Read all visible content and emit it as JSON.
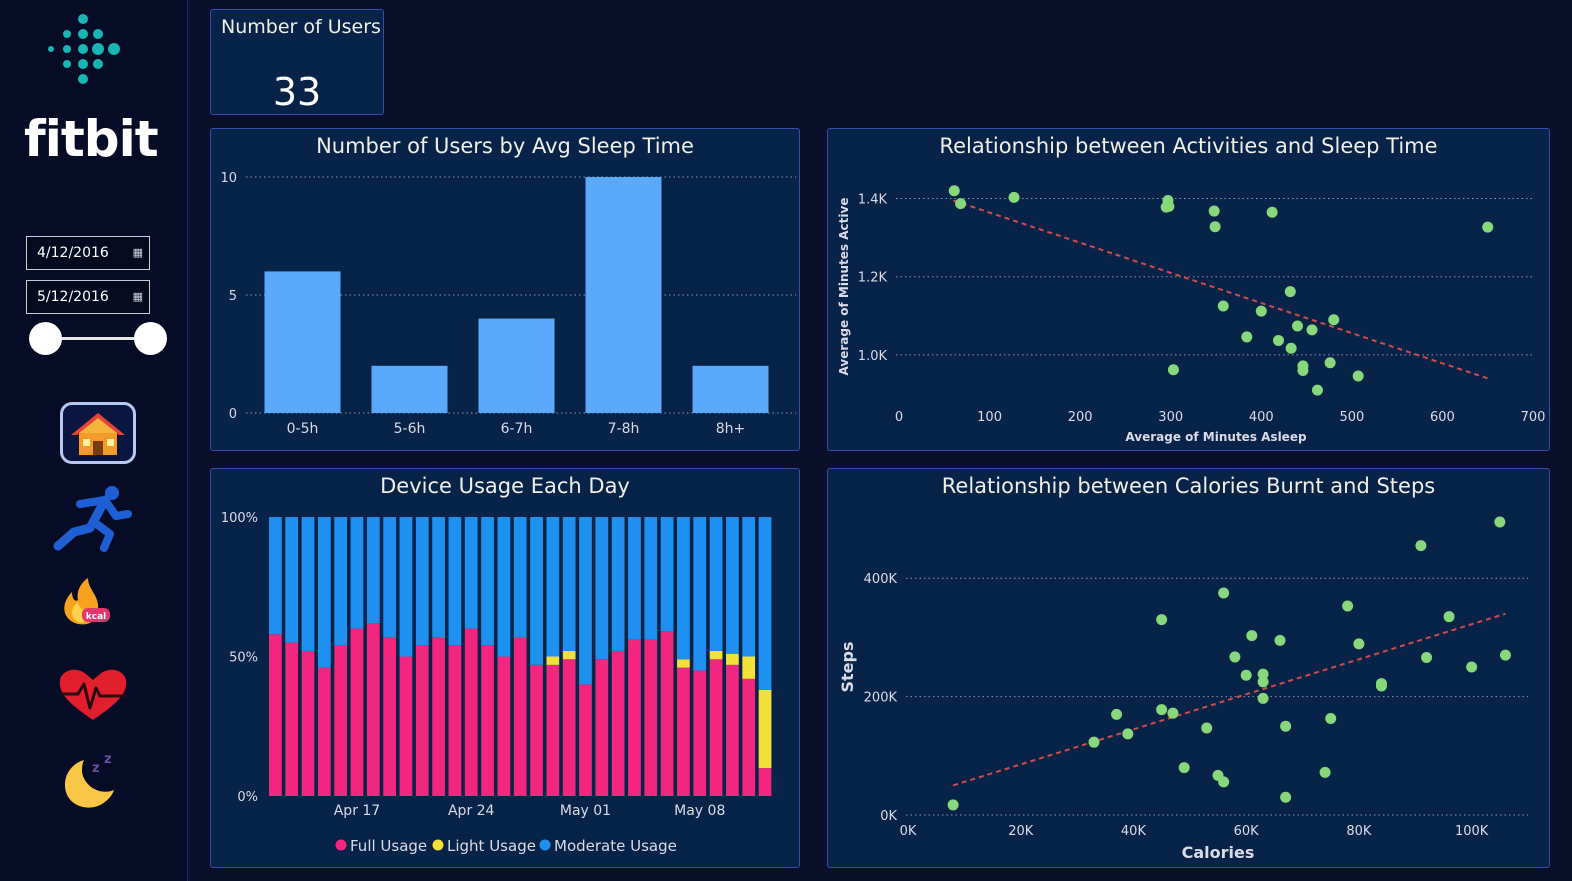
{
  "brand": {
    "name": "fitbit"
  },
  "filters": {
    "start_date": "4/12/2016",
    "end_date": "5/12/2016"
  },
  "nav": {
    "items": [
      {
        "icon": "home-icon",
        "active": true
      },
      {
        "icon": "running-icon",
        "active": false
      },
      {
        "icon": "kcal-flame-icon",
        "active": false
      },
      {
        "icon": "heartbeat-icon",
        "active": false
      },
      {
        "icon": "sleep-moon-icon",
        "active": false
      }
    ]
  },
  "kpi": {
    "label": "Number of Users",
    "value": "33"
  },
  "colors": {
    "bar": "#5aa9fa",
    "full": "#f0267f",
    "light": "#f3e13a",
    "moderate": "#1e90f0",
    "points": "#86d87a",
    "trend": "#d24a4a",
    "card_bg": "#072448"
  },
  "chart_data": [
    {
      "id": "sleep",
      "type": "bar",
      "title": "Number of Users by Avg Sleep Time",
      "categories": [
        "0-5h",
        "5-6h",
        "6-7h",
        "7-8h",
        "8h+"
      ],
      "values": [
        6,
        2,
        4,
        10,
        2
      ],
      "ylim": [
        0,
        10
      ],
      "yticks": [
        "0",
        "5",
        "10"
      ],
      "grid": true
    },
    {
      "id": "usage",
      "type": "bar",
      "stacked": "percent",
      "title": "Device Usage Each Day",
      "xticks": [
        "Apr 17",
        "Apr 24",
        "May 01",
        "May 08"
      ],
      "yticks": [
        "0%",
        "50%",
        "100%"
      ],
      "legend": "bottom",
      "series": [
        {
          "name": "Full Usage",
          "values": [
            58,
            55,
            52,
            46,
            54,
            60,
            62,
            57,
            50,
            54,
            57,
            54,
            60,
            54,
            50,
            57,
            47,
            47,
            49,
            40,
            49,
            52,
            56,
            56,
            59,
            46,
            45,
            49,
            47,
            42,
            10
          ]
        },
        {
          "name": "Light Usage",
          "values": [
            0,
            0,
            0,
            0,
            0,
            0,
            0,
            0,
            0,
            0,
            0,
            0,
            0,
            0,
            0,
            0,
            0,
            3,
            3,
            0,
            0,
            0,
            0,
            0,
            0,
            3,
            0,
            3,
            4,
            8,
            28
          ]
        },
        {
          "name": "Moderate Usage",
          "values": [
            42,
            45,
            48,
            54,
            46,
            40,
            38,
            43,
            50,
            46,
            43,
            46,
            40,
            46,
            50,
            43,
            53,
            50,
            48,
            60,
            51,
            48,
            44,
            44,
            41,
            51,
            55,
            48,
            49,
            50,
            62
          ]
        }
      ]
    },
    {
      "id": "activity",
      "type": "scatter",
      "title": "Relationship between Activities and Sleep Time",
      "xlabel": "Average of Minutes Asleep",
      "ylabel": "Average of Minutes Active",
      "xticks": [
        "0",
        "100",
        "200",
        "300",
        "400",
        "500",
        "600",
        "700"
      ],
      "yticks": [
        "1.0K",
        "1.2K",
        "1.4K"
      ],
      "xlim": [
        0,
        700
      ],
      "ylim": [
        900,
        1450
      ],
      "trend": [
        [
          60,
          1395
        ],
        [
          650,
          940
        ]
      ],
      "x": [
        61,
        68,
        127,
        295,
        297,
        298,
        348,
        349,
        412,
        358,
        432,
        400,
        384,
        433,
        419,
        440,
        480,
        456,
        446,
        446,
        462,
        476,
        303,
        507,
        650
      ],
      "y": [
        1420,
        1387,
        1403,
        1378,
        1395,
        1380,
        1368,
        1328,
        1365,
        1125,
        1162,
        1112,
        1046,
        1017,
        1037,
        1074,
        1090,
        1064,
        972,
        960,
        910,
        980,
        962,
        946,
        1327
      ]
    },
    {
      "id": "calories",
      "type": "scatter",
      "title": "Relationship between Calories Burnt and Steps",
      "xlabel": "Calories",
      "ylabel": "Steps",
      "xticks": [
        "0K",
        "20K",
        "40K",
        "60K",
        "80K",
        "100K"
      ],
      "yticks": [
        "0K",
        "200K",
        "400K"
      ],
      "xlim": [
        0,
        110000
      ],
      "ylim": [
        0,
        500000
      ],
      "trend": [
        [
          8000,
          50000
        ],
        [
          106000,
          340000
        ]
      ],
      "x": [
        8000,
        33000,
        37000,
        39000,
        45000,
        45000,
        47000,
        49000,
        53000,
        55000,
        56000,
        56000,
        58000,
        60000,
        61000,
        63000,
        63000,
        63000,
        66000,
        67000,
        67000,
        74000,
        75000,
        78000,
        80000,
        84000,
        84000,
        91000,
        92000,
        96000,
        100000,
        105000,
        106000
      ],
      "y": [
        17000,
        123000,
        170000,
        137000,
        330000,
        178000,
        172000,
        80000,
        147000,
        67000,
        56000,
        375000,
        267000,
        236000,
        303000,
        238000,
        225000,
        197000,
        295000,
        30000,
        150000,
        72000,
        163000,
        353000,
        289000,
        218000,
        222000,
        455000,
        266000,
        335000,
        250000,
        495000,
        270000
      ]
    }
  ]
}
